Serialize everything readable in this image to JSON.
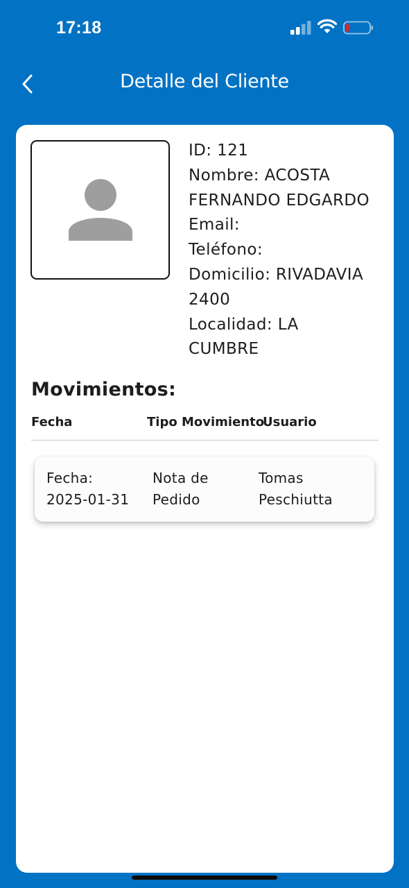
{
  "status_bar": {
    "time": "17:18"
  },
  "nav": {
    "title": "Detalle del Cliente",
    "back_icon": "chevron-left-icon"
  },
  "colors": {
    "primary": "#0272c4",
    "card": "#ffffff",
    "battery_low": "#e0242b",
    "avatar_gray": "#9e9e9e"
  },
  "client": {
    "avatar_icon": "person-icon",
    "lines": [
      "ID: 121",
      "Nombre: ACOSTA",
      "FERNANDO EDGARDO",
      "Email:",
      "Teléfono:",
      "Domicilio: RIVADAVIA",
      "2400",
      "Localidad: LA",
      "CUMBRE"
    ]
  },
  "movements": {
    "title": "Movimientos:",
    "columns": [
      "Fecha",
      "Tipo Movimiento",
      "Usuario"
    ],
    "rows": [
      {
        "fecha": [
          "Fecha:",
          "2025-01-31"
        ],
        "tipo": [
          "Nota de",
          "Pedido"
        ],
        "usuario": [
          "Tomas",
          "Peschiutta"
        ]
      }
    ]
  }
}
